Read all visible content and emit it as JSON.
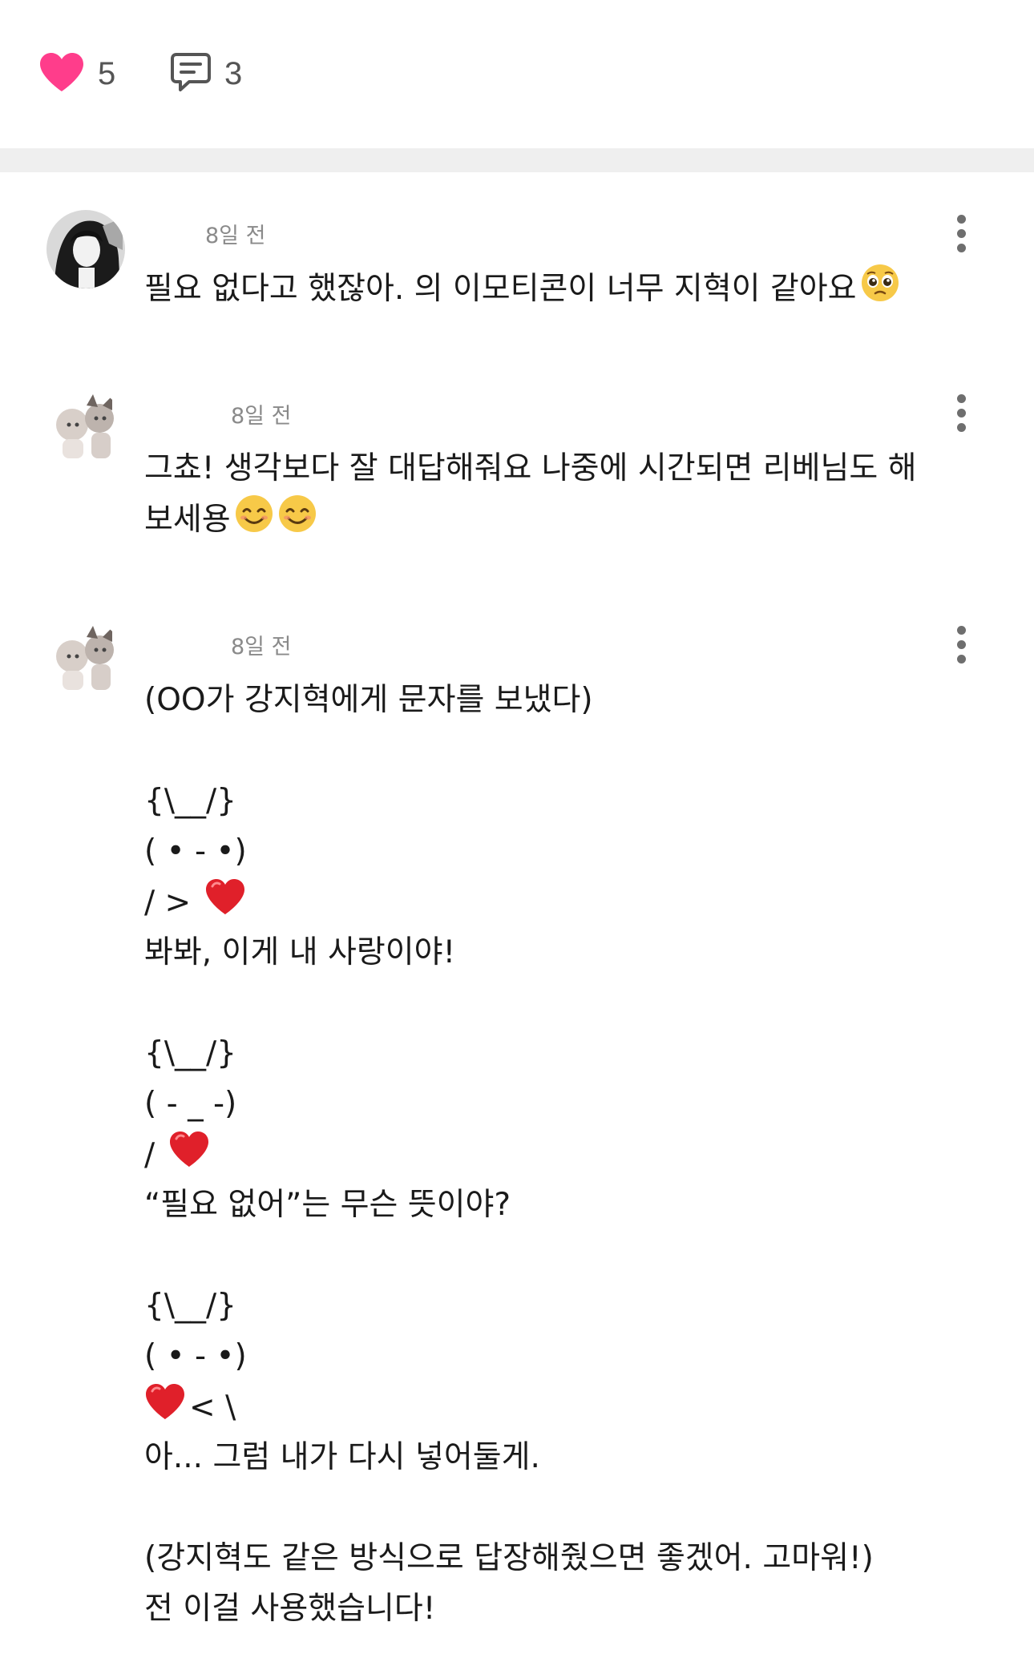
{
  "stats": {
    "likes": "5",
    "comments": "3",
    "like_color": "#ff3d8b",
    "comment_icon_color": "#555555"
  },
  "comments": [
    {
      "timestamp": "8일 전",
      "lines": [
        "필요 없다고 했잖아. 의 이모티콘이 너무 지혁이 같아요"
      ],
      "emoji": "pleading-face"
    },
    {
      "timestamp": "8일 전",
      "lines": [
        "그쵸! 생각보다 잘 대답해줘요 나중에 시간되면 리베님도 해",
        "보세용"
      ],
      "emoji": "smiling-face"
    },
    {
      "timestamp": "8일 전",
      "lines": [
        "(OO가 강지혁에게 문자를 보냈다)",
        "",
        "{\\__/}",
        "( • - •)",
        "/ >",
        "봐봐, 이게 내 사랑이야!",
        "",
        "{\\__/}",
        "( - _ -)",
        "/",
        "“필요 없어”는 무슨 뜻이야?",
        "",
        "{\\__/}",
        "( • - •)",
        "< \\",
        "아... 그럼 내가 다시 넣어둘게.",
        "",
        "(강지혁도 같은 방식으로 답장해줬으면 좋겠어. 고마워!)",
        "전 이걸 사용했습니다!"
      ],
      "emoji": "red-heart"
    }
  ]
}
